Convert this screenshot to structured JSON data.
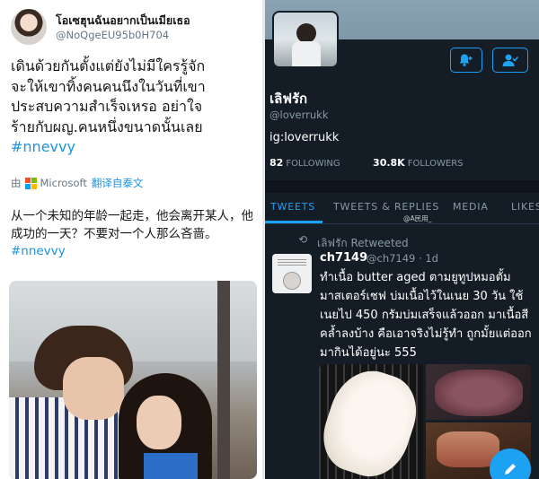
{
  "left_tweet": {
    "display_name": "โอเซฮุนฉันอยากเป็นเมียเธอ",
    "handle": "@NoQgeEU95b0H704",
    "text_lines": [
      "เดินด้วยกันตั้งแต่ยังไม่มีใครรู้จัก",
      "จะให้เขาทิ้งคนคนนึงในวันที่เขา",
      "ประสบความสำเร็จเหรอ  อย่าใจ",
      "ร้ายกับผญ.คนหนึ่งขนาดนั้นเลย"
    ],
    "hashtag": "#nnevvy",
    "translation": {
      "by": "由",
      "provider": "Microsoft",
      "link": "翻译自泰文"
    },
    "translated_text": "从一个未知的年龄一起走，他会离开某人，他成功的一天？不要对一个人那么吝啬。",
    "translated_hashtag": "#nnevvy"
  },
  "profile": {
    "name": "เลิฟรัก",
    "handle": "@loverrukk",
    "bio": "ig:loverrukk",
    "following_count": "82",
    "following_label": "FOLLOWING",
    "followers_count": "30.8K",
    "followers_label": "FOLLOWERS",
    "notify_icon": "bell-plus-icon",
    "follow_icon": "person-check-icon"
  },
  "tabs": [
    {
      "label": "TWEETS",
      "active": true
    },
    {
      "label": "TWEETS & REPLIES",
      "active": false
    },
    {
      "label": "MEDIA",
      "active": false
    },
    {
      "label": "LIKES",
      "active": false
    }
  ],
  "watermark": "@A民用_",
  "retweet": {
    "label": "เลิฟรัก Retweeted",
    "author": "ch7149",
    "author_meta": "@ch7149 · 1d",
    "text": "ทำเนื้อ butter aged ตามยูทูปหมอตั้ม มาสเตอร์เชฟ บ่มเนื้อไว้ในเนย 30 วัน ใช้เนยไป 450 กรัมบ่มเสร็จแล้วออก มาเนื้อสีคล้ำลงบ้าง คือเอาจริงไม่รู้ทำ ถูกมั้ยแต่ออกมากินได้อยู่นะ 555"
  },
  "colors": {
    "twitter_blue": "#1da1f2",
    "dark_bg": "#141d26",
    "link_blue": "#1b95e0"
  }
}
